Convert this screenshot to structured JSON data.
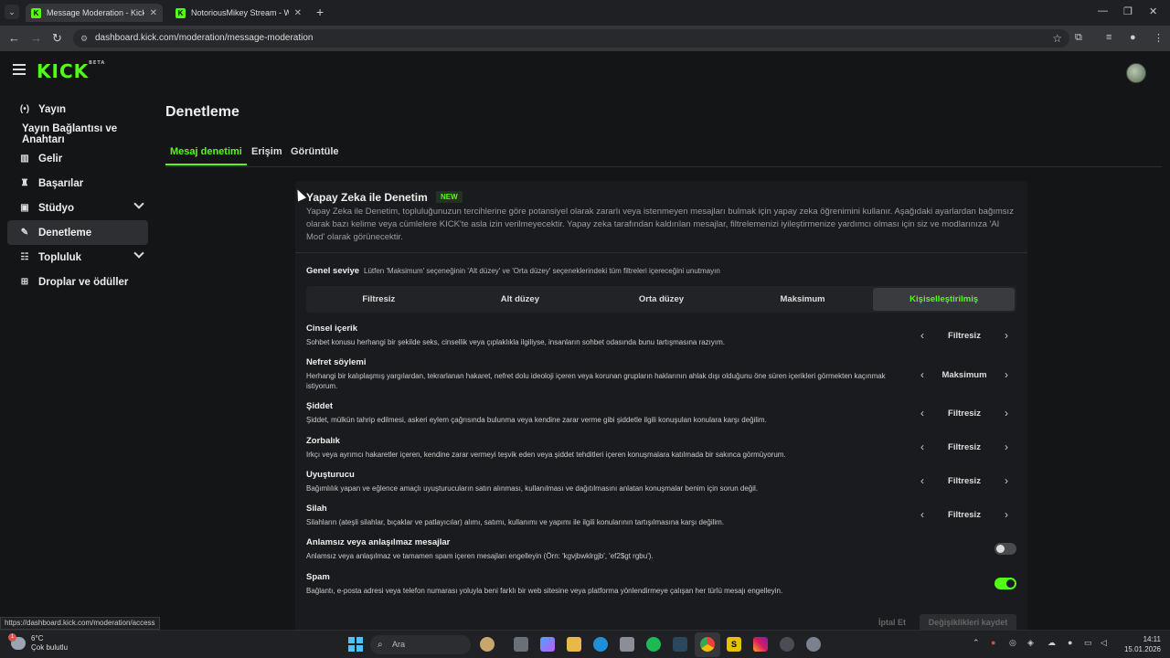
{
  "browser": {
    "tabs": [
      {
        "title": "Message Moderation - Kick Da",
        "active": true
      },
      {
        "title": "NotoriousMikey Stream - Watc",
        "active": false
      }
    ],
    "url": "dashboard.kick.com/moderation/message-moderation",
    "status_url": "https://dashboard.kick.com/moderation/access"
  },
  "app": {
    "logo": "KICK",
    "logo_badge": "BETA"
  },
  "sidebar": {
    "items": [
      {
        "label": "Yayın",
        "icon": "broadcast-icon"
      },
      {
        "label": "Yayın Bağlantısı ve Anahtarı",
        "icon": ""
      },
      {
        "label": "Gelir",
        "icon": "revenue-icon"
      },
      {
        "label": "Başarılar",
        "icon": "trophy-icon"
      },
      {
        "label": "Stüdyo",
        "icon": "studio-icon"
      },
      {
        "label": "Denetleme",
        "icon": "wrench-icon"
      },
      {
        "label": "Topluluk",
        "icon": "community-icon"
      },
      {
        "label": "Droplar ve ödüller",
        "icon": "drops-icon"
      }
    ]
  },
  "main": {
    "title": "Denetleme",
    "tabs": [
      "Mesaj denetimi",
      "Erişim",
      "Görüntüle"
    ]
  },
  "ai": {
    "title": "Yapay Zeka ile Denetim",
    "badge": "NEW",
    "description": "Yapay Zeka ile Denetim, topluluğunuzun tercihlerine göre potansiyel olarak zararlı veya istenmeyen mesajları bulmak için yapay zeka öğrenimini kullanır. Aşağıdaki ayarlardan bağımsız olarak bazı kelime veya cümlelere KICK'te asla izin verilmeyecektir. Yapay zeka tarafından kaldırılan mesajlar, filtrelemenizi iyileştirmenize yardımcı olması için siz ve modlarınıza 'AI Mod' olarak görünecektir.",
    "general_label": "Genel seviye",
    "general_hint": "Lütfen 'Maksimum' seçeneğinin 'Alt düzey' ve 'Orta düzey' seçeneklerindeki tüm filtreleri içereceğini unutmayın",
    "levels": [
      "Filtresiz",
      "Alt düzey",
      "Orta düzey",
      "Maksimum",
      "Kişiselleştirilmiş"
    ],
    "rules": [
      {
        "title": "Cinsel içerik",
        "desc": "Sohbet konusu herhangi bir şekilde seks, cinsellik veya çıplaklıkla ilgiliyse, insanların sohbet odasında bunu tartışmasına razıyım.",
        "value": "Filtresiz"
      },
      {
        "title": "Nefret söylemi",
        "desc": "Herhangi bir kalıplaşmış yargılardan, tekrarlanan hakaret, nefret dolu ideoloji içeren veya korunan grupların haklarının ahlak dışı olduğunu öne süren içerikleri görmekten kaçınmak istiyorum.",
        "value": "Maksimum"
      },
      {
        "title": "Şiddet",
        "desc": "Şiddet, mülkün tahrip edilmesi, askeri eylem çağrısında bulunma veya kendine zarar verme gibi şiddetle ilgili konuşulan konulara karşı değilim.",
        "value": "Filtresiz"
      },
      {
        "title": "Zorbalık",
        "desc": "Irkçı veya ayrımcı hakaretler içeren, kendine zarar vermeyi teşvik eden veya şiddet tehditleri içeren konuşmalara katılmada bir sakınca görmüyorum.",
        "value": "Filtresiz"
      },
      {
        "title": "Uyuşturucu",
        "desc": "Bağımlılık yapan ve eğlence amaçlı uyuşturucuların satın alınması, kullanılması ve dağıtılmasını anlatan konuşmalar benim için sorun değil.",
        "value": "Filtresiz"
      },
      {
        "title": "Silah",
        "desc": "Silahların (ateşli silahlar, bıçaklar ve patlayıcılar) alımı, satımı, kullanımı ve yapımı ile ilgili konularının tartışılmasına karşı değilim.",
        "value": "Filtresiz"
      }
    ],
    "toggles": [
      {
        "title": "Anlamsız veya anlaşılmaz mesajlar",
        "desc": "Anlamsız veya anlaşılmaz ve tamamen spam içeren mesajları engelleyin (Örn: 'kgvjbwklrgjb', 'ef2$gt rgbu').",
        "on": false
      },
      {
        "title": "Spam",
        "desc": "Bağlantı, e-posta adresi veya telefon numarası yoluyla beni farklı bir web sitesine veya platforma yönlendirmeye çalışan her türlü mesajı engelleyin.",
        "on": true
      }
    ],
    "cancel_label": "İptal Et",
    "save_label": "Değişiklikleri kaydet"
  },
  "taskbar": {
    "weather_temp": "6°C",
    "weather_desc": "Çok bulutlu",
    "weather_badge": "1",
    "search_placeholder": "Ara",
    "time": "14:11",
    "date": "15.01.2026"
  },
  "colors": {
    "accent": "#53fc18",
    "background": "#141517",
    "card": "#1a1b1e"
  }
}
